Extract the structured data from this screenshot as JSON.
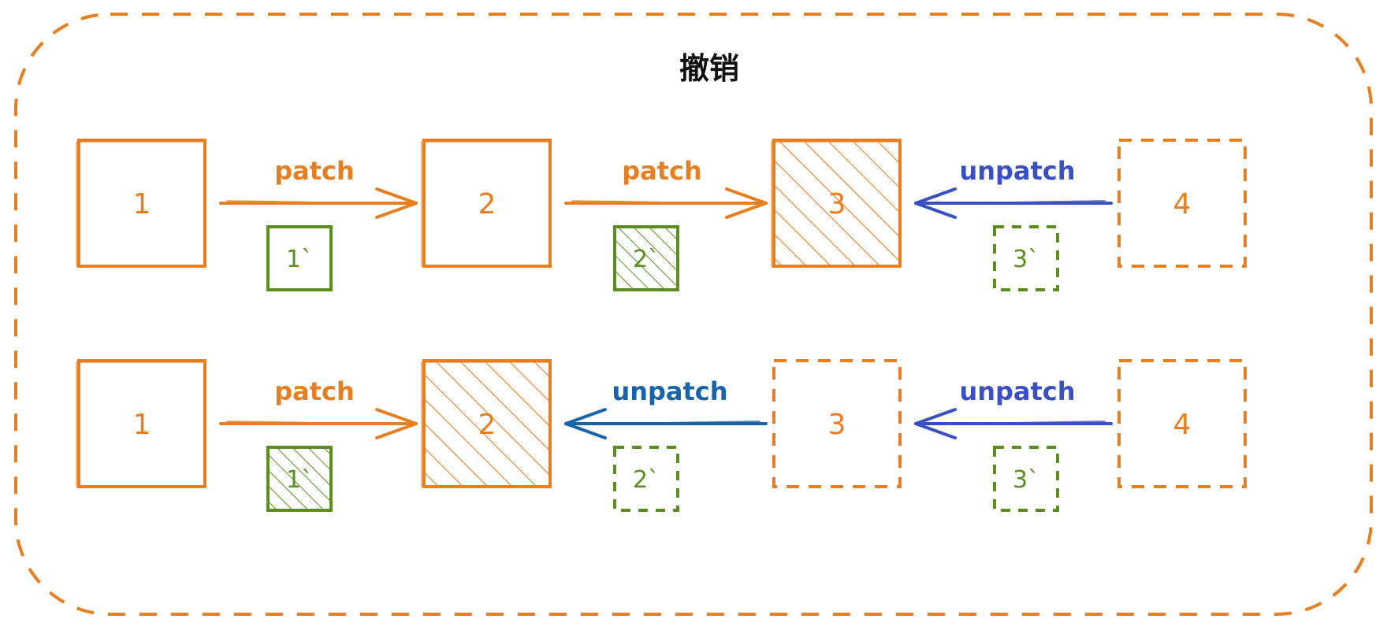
{
  "title": "撤销",
  "colors": {
    "orange": "#e67e22",
    "green": "#5a8f1f",
    "blue": "#1864ab",
    "indigo": "#3b4fc4",
    "text": "#111111"
  },
  "rows": [
    {
      "boxes": [
        {
          "label": "1",
          "style": "solid"
        },
        {
          "label": "2",
          "style": "solid"
        },
        {
          "label": "3",
          "style": "hatched"
        },
        {
          "label": "4",
          "style": "dashed"
        }
      ],
      "links": [
        {
          "label": "patch",
          "direction": "right",
          "patch_label": "1`",
          "patch_style": "solid"
        },
        {
          "label": "patch",
          "direction": "right",
          "patch_label": "2`",
          "patch_style": "hatched"
        },
        {
          "label": "unpatch",
          "direction": "left",
          "patch_label": "3`",
          "patch_style": "dashed"
        }
      ]
    },
    {
      "boxes": [
        {
          "label": "1",
          "style": "solid"
        },
        {
          "label": "2",
          "style": "hatched"
        },
        {
          "label": "3",
          "style": "dashed"
        },
        {
          "label": "4",
          "style": "dashed"
        }
      ],
      "links": [
        {
          "label": "patch",
          "direction": "right",
          "patch_label": "1`",
          "patch_style": "hatched"
        },
        {
          "label": "unpatch",
          "direction": "left",
          "patch_label": "2`",
          "patch_style": "dashed"
        },
        {
          "label": "unpatch",
          "direction": "left",
          "patch_label": "3`",
          "patch_style": "dashed"
        }
      ]
    }
  ]
}
